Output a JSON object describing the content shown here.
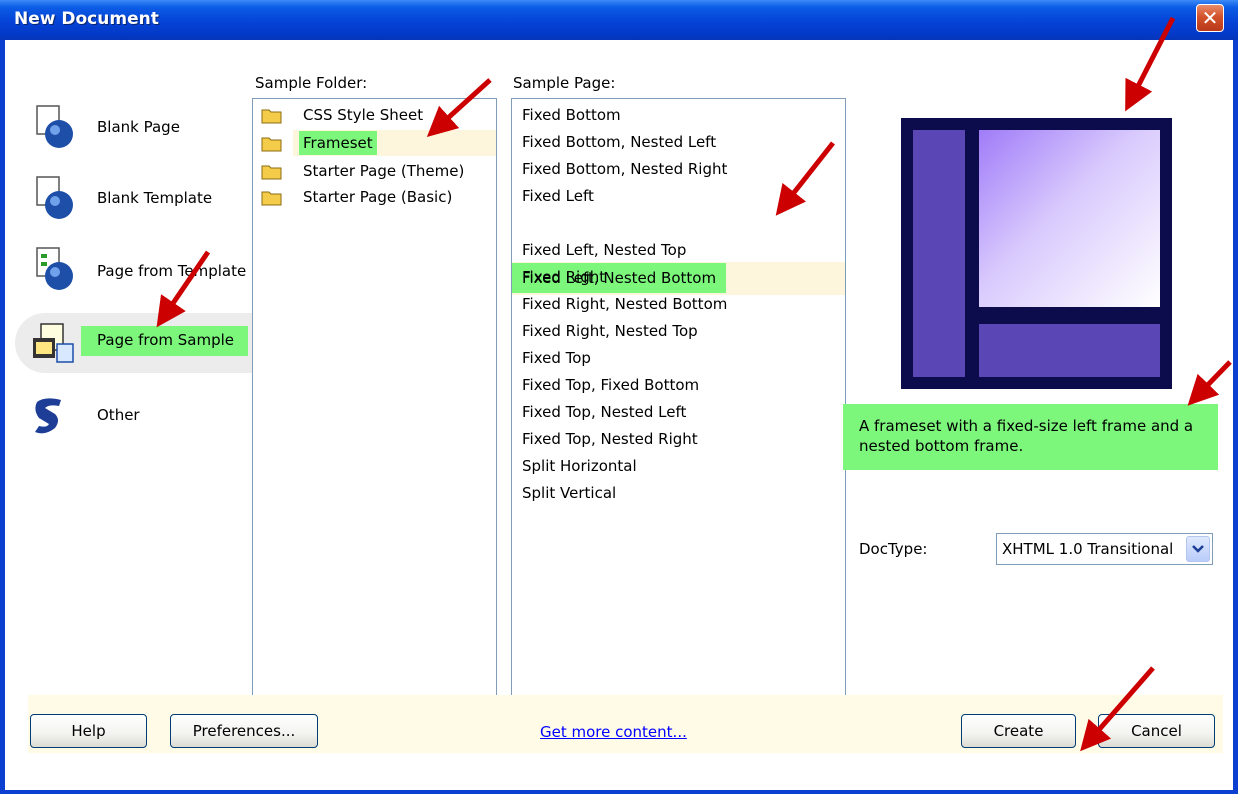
{
  "window": {
    "title": "New Document",
    "close_glyph": "✕"
  },
  "categories": [
    {
      "label": "Blank Page",
      "icon": "blank-page-icon"
    },
    {
      "label": "Blank Template",
      "icon": "blank-template-icon"
    },
    {
      "label": "Page from Template",
      "icon": "page-from-template-icon"
    },
    {
      "label": "Page from Sample",
      "icon": "page-from-sample-icon",
      "selected": true
    },
    {
      "label": "Other",
      "icon": "other-icon"
    }
  ],
  "sample_folder": {
    "label": "Sample Folder:",
    "items": [
      "CSS Style Sheet",
      "Frameset",
      "Starter Page (Theme)",
      "Starter Page (Basic)"
    ],
    "selected": "Frameset"
  },
  "sample_page": {
    "label": "Sample Page:",
    "items": [
      "Fixed Bottom",
      "Fixed Bottom, Nested Left",
      "Fixed Bottom, Nested Right",
      "Fixed Left",
      "Fixed Left, Nested Bottom",
      "Fixed Left, Nested Top",
      "Fixed Right",
      "Fixed Right, Nested Bottom",
      "Fixed Right, Nested Top",
      "Fixed Top",
      "Fixed Top, Fixed Bottom",
      "Fixed Top, Nested Left",
      "Fixed Top, Nested Right",
      "Split Horizontal",
      "Split Vertical"
    ],
    "selected": "Fixed Left, Nested Bottom"
  },
  "description": "A frameset with a fixed-size left frame and a nested bottom frame.",
  "doctype": {
    "label": "DocType:",
    "value": "XHTML 1.0 Transitional"
  },
  "footer": {
    "help": "Help",
    "preferences": "Preferences...",
    "link": "Get more content...",
    "create": "Create",
    "cancel": "Cancel"
  },
  "colors": {
    "highlight": "#7cf77c",
    "titlebar": "#0543d6",
    "preview_frame": "#0c0b4b",
    "preview_panel": "#5a47b5",
    "arrow": "#cc0000"
  }
}
